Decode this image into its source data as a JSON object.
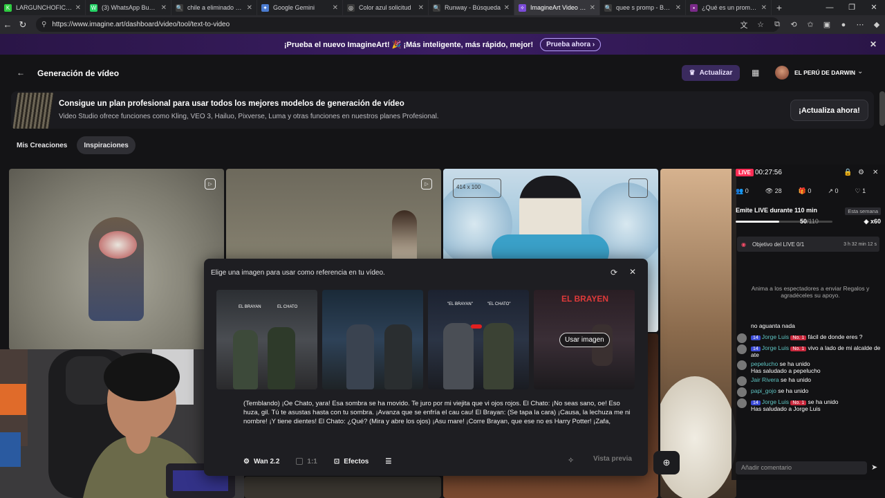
{
  "browser": {
    "tabs": [
      {
        "title": "LARGUNCHOFICIAL Str",
        "icon": "K",
        "color": "#2ecc40"
      },
      {
        "title": "(3) WhatsApp Business",
        "icon": "W",
        "color": "#25d366"
      },
      {
        "title": "chile a eliminado el afr",
        "icon": "🔍",
        "color": "#3a3a3a"
      },
      {
        "title": "Google Gemini",
        "icon": "✦",
        "color": "#4a7bd0"
      },
      {
        "title": "Color azul solicitud",
        "icon": "◎",
        "color": "#3a3a3a"
      },
      {
        "title": "Runway - Búsqueda",
        "icon": "🔍",
        "color": "#3a3a3a"
      },
      {
        "title": "ImagineArt Video Stud",
        "icon": "✧",
        "color": "#7b4bd8",
        "active": true
      },
      {
        "title": "quee s promp - Búsque",
        "icon": "🔍",
        "color": "#3a3a3a"
      },
      {
        "title": "¿Qué es un prompt y c",
        "icon": "▪",
        "color": "#7b2a8a"
      }
    ],
    "new_tab": "+",
    "url": "https://www.imagine.art/dashboard/video/tool/text-to-video"
  },
  "promo": {
    "text": "¡Prueba el nuevo ImagineArt! 🎉 ¡Más inteligente, más rápido, mejor!",
    "button": "Prueba ahora ›",
    "close": "✕"
  },
  "header": {
    "back": "←",
    "title": "Generación de vídeo",
    "upgrade": "Actualizar",
    "user": "EL PERÚ DE DARWIN"
  },
  "banner": {
    "title": "Consigue un plan profesional para usar todos los mejores modelos de generación de vídeo",
    "subtitle": "Video Studio ofrece funciones como Kling, VEO 3, Hailuo, Pixverse, Luma y otras funciones en nuestros planes Profesional.",
    "cta": "¡Actualiza ahora!"
  },
  "tabs": [
    {
      "label": "Mis Creaciones"
    },
    {
      "label": "Inspiraciones",
      "active": true
    }
  ],
  "gallery": {
    "overlay_text": "414 x 100"
  },
  "modal": {
    "title": "Elige una imagen para usar como referencia en tu vídeo.",
    "use_image": "Usar imagen",
    "image_labels": [
      [
        "EL BRAYAN",
        "EL CHATO"
      ],
      [],
      [
        "\"EL BRAYAN\"",
        "\"EL CHATO\""
      ],
      [
        "EL BRAYEN"
      ]
    ],
    "prompt": "(Temblando) ¡Oe Chato, yara! Esa sombra se ha movido. Te juro por mi viejita que vi ojos rojos. El Chato: ¡No seas sano, oe! Eso huza, gil. Tú te asustas hasta con tu sombra. ¡Avanza que se enfría el cau cau! El Brayan: (Se tapa la cara) ¡Causa, la lechuza me ni nombre! ¡Y tiene dientes! El Chato: ¿Qué? (Mira y abre los ojos) ¡Asu mare! ¡Corre Brayan, que ese no es Harry Potter! ¡Zafa,",
    "model": "Wan 2.2",
    "ratio": "1:1",
    "effects": "Efectos",
    "preview": "Vista previa"
  },
  "live": {
    "badge": "LIVE",
    "time": "00:27:56",
    "stats": [
      "0",
      "28",
      "0",
      "0",
      "1"
    ],
    "goal_label": "Emite LIVE durante 110 min",
    "week": "Esta semana",
    "progress": 0.45,
    "progress_current": "50",
    "progress_total": "/110",
    "bonus": "x60",
    "objective": "Objetivo del LIVE 0/1",
    "objective_time": "3 h 32 min 12 s",
    "hint": "Anima a los espectadores a enviar Regalos y agradéceles su apoyo.",
    "comment_placeholder": "Añadir comentario",
    "chat": [
      {
        "user": "",
        "text": "no aguanta nada",
        "noavatar": true
      },
      {
        "user": "Jorge Luis",
        "badge": "14",
        "no1": "No. 1",
        "text": "fácil de donde eres ?"
      },
      {
        "user": "Jorge Luis",
        "badge": "14",
        "no1": "No. 1",
        "text": "vivo a lado de mi alcalde de ate"
      },
      {
        "user": "pepelucho",
        "text": "se ha unido",
        "extra": "Has saludado a pepelucho"
      },
      {
        "user": "Jair Rivera",
        "text": "se ha unido"
      },
      {
        "user": "papi_gojo",
        "text": "se ha unido"
      },
      {
        "user": "Jorge Luis",
        "badge": "14",
        "no1": "No. 1",
        "text": "se ha unido",
        "extra": "Has saludado a Jorge Luis"
      }
    ]
  }
}
